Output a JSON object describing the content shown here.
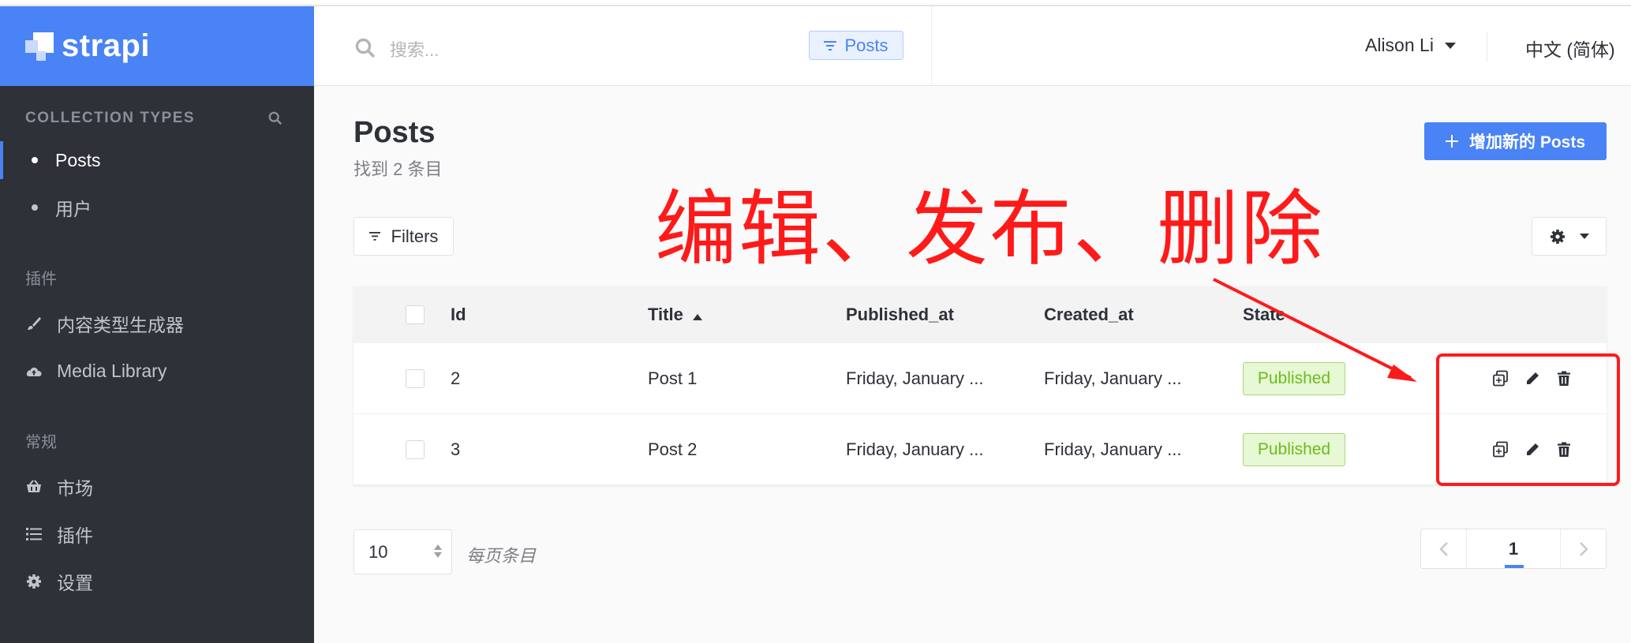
{
  "brand": {
    "name": "strapi"
  },
  "sidebar": {
    "collection_header": "COLLECTION TYPES",
    "collection_items": [
      {
        "label": "Posts",
        "active": true
      },
      {
        "label": "用户",
        "active": false
      }
    ],
    "plugins_label": "插件",
    "plugin_items": [
      {
        "label": "内容类型生成器",
        "icon": "brush-icon"
      },
      {
        "label": "Media Library",
        "icon": "cloud-upload-icon"
      }
    ],
    "general_label": "常规",
    "general_items": [
      {
        "label": "市场",
        "icon": "basket-icon"
      },
      {
        "label": "插件",
        "icon": "list-icon"
      },
      {
        "label": "设置",
        "icon": "gear-icon"
      }
    ]
  },
  "header": {
    "search_placeholder": "搜索...",
    "filter_chip": "Posts",
    "user_name": "Alison Li",
    "language": "中文 (简体)"
  },
  "main": {
    "title": "Posts",
    "subtitle": "找到 2 条目",
    "add_button": "增加新的 Posts",
    "filters_button": "Filters",
    "annotation": "编辑、发布、删除",
    "table": {
      "columns": [
        "Id",
        "Title",
        "Published_at",
        "Created_at",
        "State"
      ],
      "sorted_column": "Title",
      "rows": [
        {
          "id": "2",
          "title": "Post 1",
          "published_at": "Friday, January ...",
          "created_at": "Friday, January ...",
          "state": "Published"
        },
        {
          "id": "3",
          "title": "Post 2",
          "published_at": "Friday, January ...",
          "created_at": "Friday, January ...",
          "state": "Published"
        }
      ]
    },
    "per_page_value": "10",
    "per_page_label": "每页条目",
    "current_page": "1"
  },
  "colors": {
    "accent": "#4a83f5",
    "sidebar_bg": "#2e3138",
    "annotation_red": "#ff1a1a",
    "published_text": "#6dbb1a"
  }
}
